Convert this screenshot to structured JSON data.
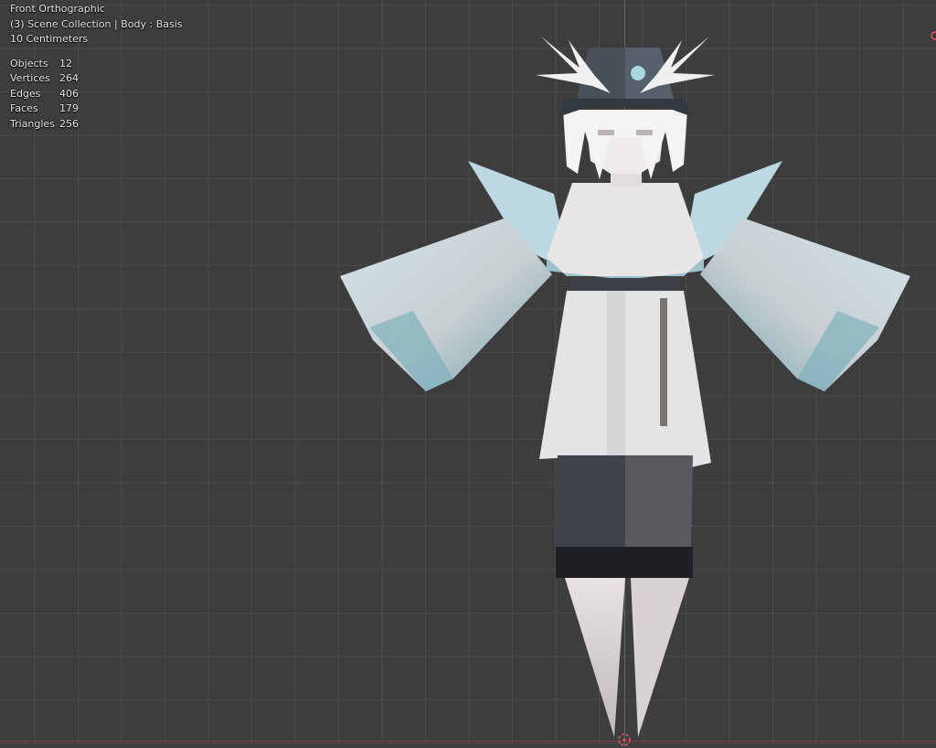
{
  "viewport": {
    "view_name": "Front Orthographic",
    "collection_info": "(3) Scene Collection | Body : Basis",
    "scale": "10 Centimeters",
    "stats": [
      {
        "label": "Objects",
        "value": "12"
      },
      {
        "label": "Vertices",
        "value": "264"
      },
      {
        "label": "Edges",
        "value": "406"
      },
      {
        "label": "Faces",
        "value": "179"
      },
      {
        "label": "Triangles",
        "value": "256"
      }
    ]
  },
  "colors": {
    "background": "#3d3d3d",
    "grid": "#4a4a4a",
    "z_axis": "#2f6fb3",
    "x_axis": "#8a3a3a",
    "origin_marker": "#e25c5c"
  }
}
